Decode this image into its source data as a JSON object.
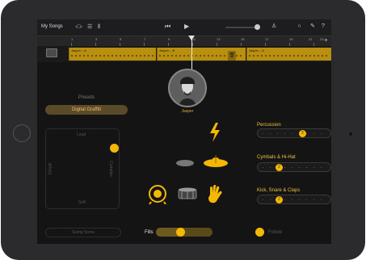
{
  "toolbar": {
    "my_songs": "My Songs"
  },
  "ruler": {
    "numbers": [
      "1",
      "3",
      "5",
      "7",
      "9",
      "11",
      "13",
      "15",
      "17",
      "19",
      "21",
      "23"
    ]
  },
  "track": {
    "regions": [
      {
        "label": "Jasper – A"
      },
      {
        "label": "Jasper – B"
      },
      {
        "label": "Jasper – A"
      }
    ]
  },
  "drummer": {
    "name": "Jasper"
  },
  "presets": {
    "label": "Presets",
    "selected": "Digital Graffiti"
  },
  "pad": {
    "top": "Loud",
    "bottom": "Soft",
    "left": "Simple",
    "right": "Complex"
  },
  "sliders": [
    {
      "label": "Percussion",
      "value": "3",
      "level": 0.65
    },
    {
      "label": "Cymbals & Hi-Hat",
      "value": "2",
      "level": 0.25
    },
    {
      "label": "Kick, Snare & Claps",
      "value": "2",
      "level": 0.25
    }
  ],
  "bottom": {
    "swing": "Swing Some",
    "fills": "Fills",
    "follow": "Follow"
  },
  "colors": {
    "accent": "#f5b800",
    "region": "#b98f10",
    "background": "#141414"
  }
}
